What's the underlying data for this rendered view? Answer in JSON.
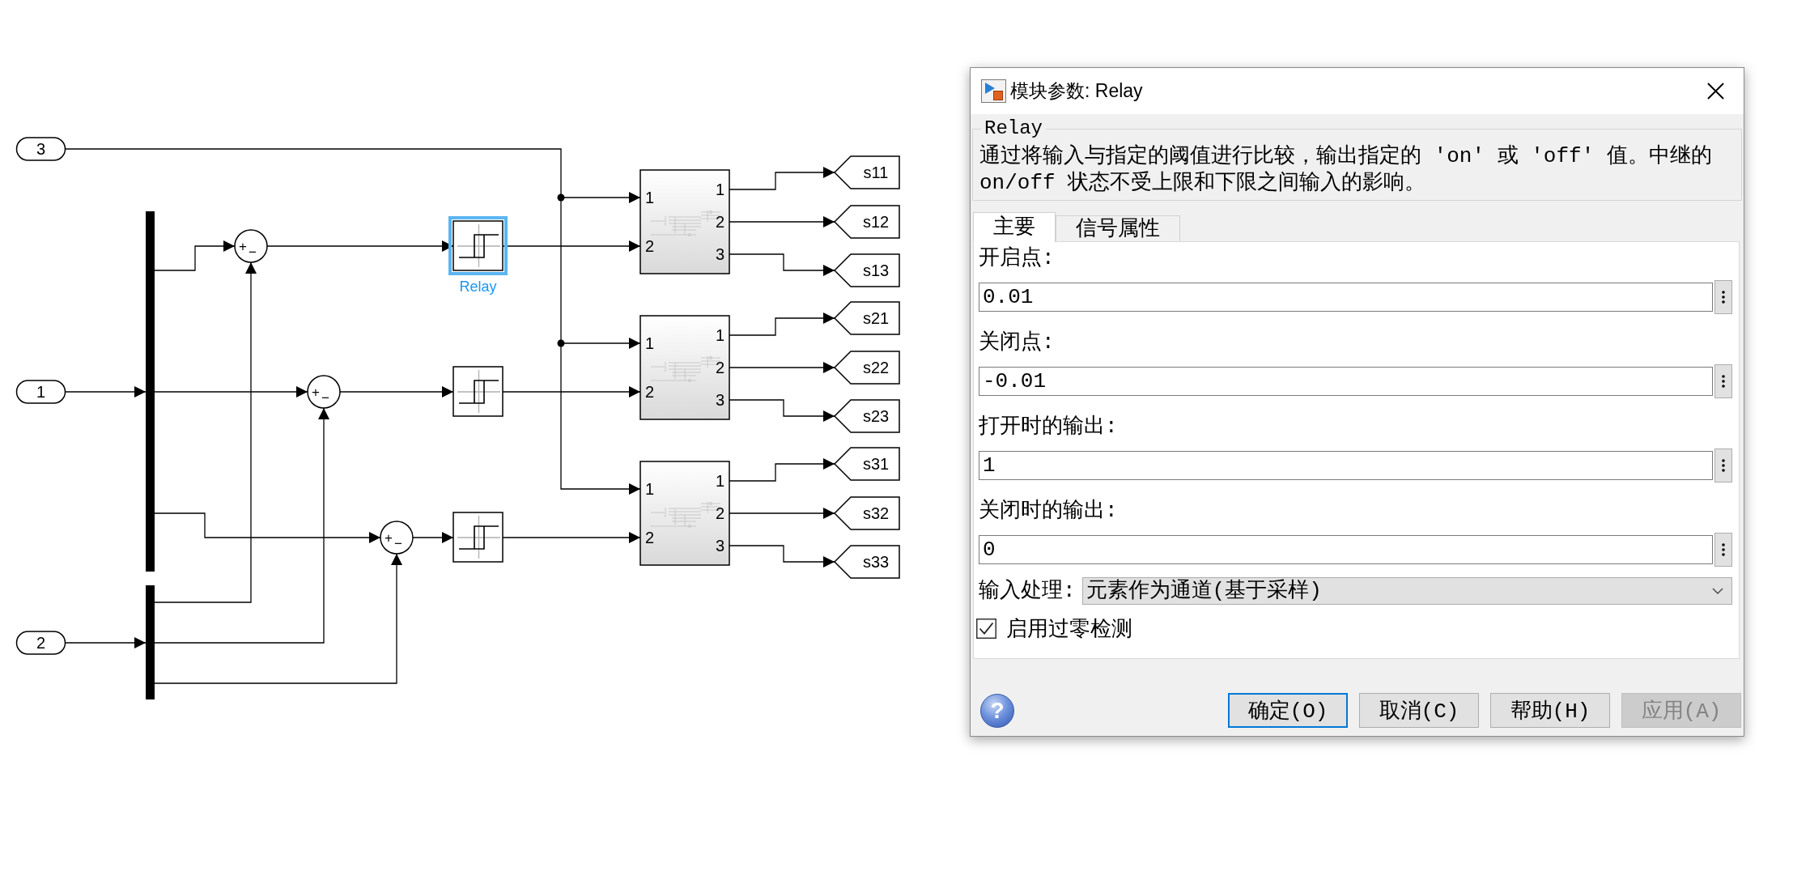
{
  "diagram": {
    "inports": [
      {
        "number": "3"
      },
      {
        "number": "1"
      },
      {
        "number": "2"
      }
    ],
    "sums": [
      {
        "signs": [
          "+",
          "−"
        ]
      },
      {
        "signs": [
          "+",
          "−"
        ]
      },
      {
        "signs": [
          "+",
          "−"
        ]
      }
    ],
    "relays": [
      {
        "name": "Relay",
        "selected": true
      },
      {
        "selected": false
      },
      {
        "selected": false
      }
    ],
    "subsystems": [
      {
        "inputs": [
          "1",
          "2"
        ],
        "outputs": [
          "1",
          "2",
          "3"
        ]
      },
      {
        "inputs": [
          "1",
          "2"
        ],
        "outputs": [
          "1",
          "2",
          "3"
        ]
      },
      {
        "inputs": [
          "1",
          "2"
        ],
        "outputs": [
          "1",
          "2",
          "3"
        ]
      }
    ],
    "goto_tags": [
      "s11",
      "s12",
      "s13",
      "s21",
      "s22",
      "s23",
      "s31",
      "s32",
      "s33"
    ]
  },
  "dialog": {
    "title": "模块参数: Relay",
    "block_type": "Relay",
    "description": "通过将输入与指定的阈值进行比较，输出指定的 'on' 或 'off' 值。中继的 on/off 状态不受上限和下限之间输入的影响。",
    "tabs": [
      {
        "label": "主要",
        "selected": true
      },
      {
        "label": "信号属性",
        "selected": false
      }
    ],
    "parameters": [
      {
        "label": "开启点:",
        "value": "0.01"
      },
      {
        "label": "关闭点:",
        "value": "-0.01"
      },
      {
        "label": "打开时的输出:",
        "value": "1"
      },
      {
        "label": "关闭时的输出:",
        "value": "0"
      }
    ],
    "input_processing": {
      "label": "输入处理:",
      "value": "元素作为通道(基于采样)"
    },
    "zero_crossing": {
      "label": "启用过零检测",
      "checked": true
    },
    "help_button": "?",
    "buttons": [
      {
        "label": "确定(O)",
        "default": true,
        "disabled": false
      },
      {
        "label": "取消(C)",
        "default": false,
        "disabled": false
      },
      {
        "label": "帮助(H)",
        "default": false,
        "disabled": false
      },
      {
        "label": "应用(A)",
        "default": false,
        "disabled": true
      }
    ]
  }
}
